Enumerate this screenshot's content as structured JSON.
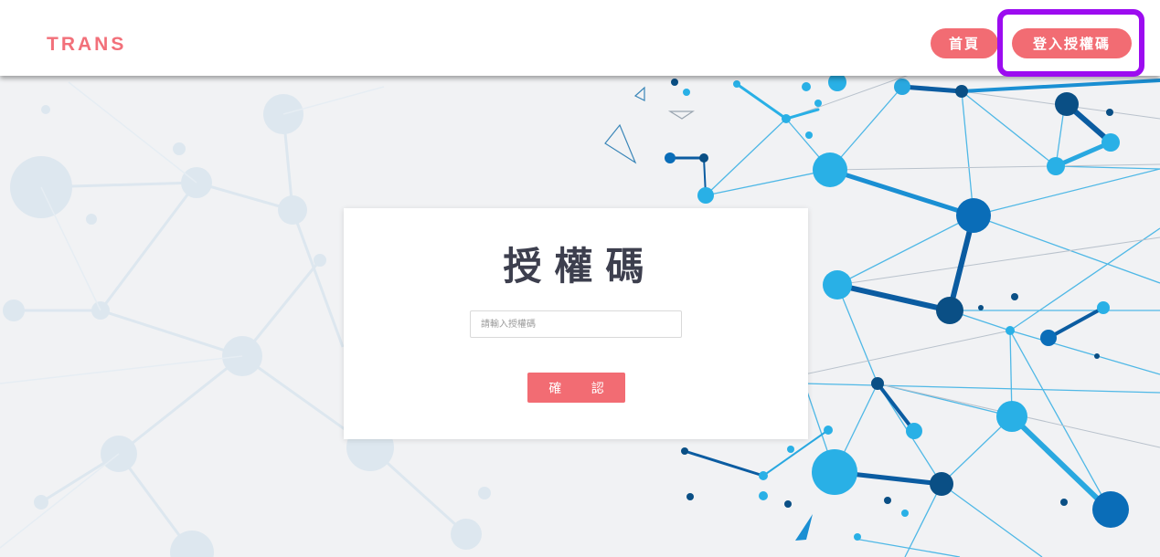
{
  "header": {
    "brand": "TRANS",
    "nav": {
      "home_label": "首頁",
      "login_code_label": "登入授權碼"
    }
  },
  "auth_card": {
    "title": "授權碼",
    "input_placeholder": "請輸入授權碼",
    "input_value": "",
    "confirm_label": "確 認"
  },
  "colors": {
    "brand": "#f2707a",
    "button": "#f26c73",
    "highlight": "#9c0cf0",
    "title_text": "#3d3f4e",
    "network_light": "#29b0e6",
    "network_dark": "#0a4f85"
  },
  "icons": {
    "background": "network-graphic"
  }
}
